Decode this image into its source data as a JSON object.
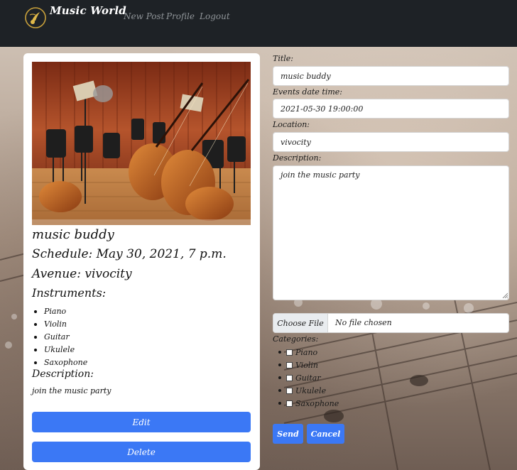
{
  "navbar": {
    "brand": "Music World",
    "links": [
      "New Post",
      "Profile",
      "Logout"
    ]
  },
  "post": {
    "title": "music buddy",
    "schedule": "Schedule: May 30, 2021, 7 p.m.",
    "avenue": "Avenue: vivocity",
    "instruments_heading": "Instruments:",
    "instruments": [
      "Piano",
      "Violin",
      "Guitar",
      "Ukulele",
      "Saxophone"
    ],
    "description_heading": "Description:",
    "description": "join the music party",
    "edit_label": "Edit",
    "delete_label": "Delete"
  },
  "form": {
    "title_label": "Title:",
    "title_value": "music buddy",
    "datetime_label": "Events date time:",
    "datetime_value": "2021-05-30 19:00:00",
    "location_label": "Location:",
    "location_value": "vivocity",
    "description_label": "Description:",
    "description_value": "join the music party",
    "file_button_label": "Choose File",
    "file_status": "No file chosen",
    "categories_label": "Categories:",
    "categories": [
      "Piano",
      "Violin",
      "Guitar",
      "Ukulele",
      "Saxophone"
    ],
    "send_label": "Send",
    "cancel_label": "Cancel"
  },
  "colors": {
    "navbar": "#1e2226",
    "primary": "#3b78f5",
    "nav_link": "#8f9498"
  },
  "icons": {
    "brand": "music-note-wing-icon"
  }
}
